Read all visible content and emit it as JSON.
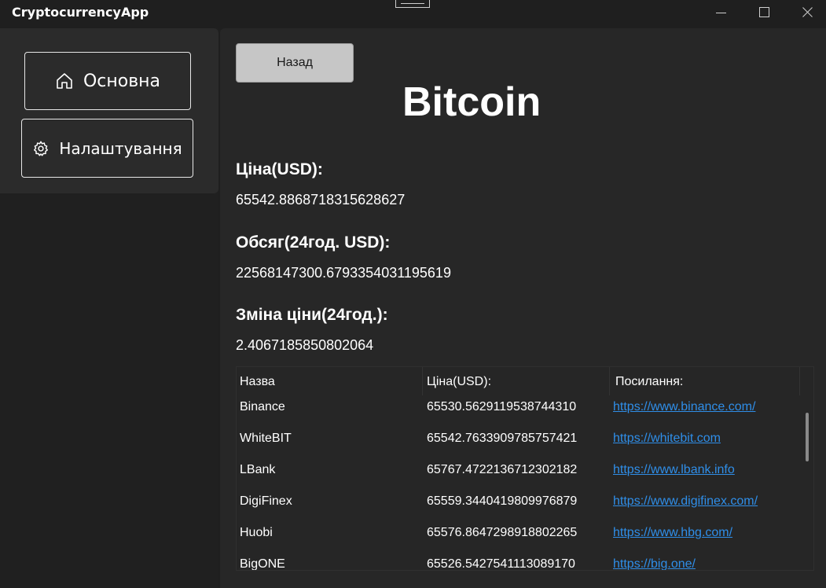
{
  "window": {
    "title": "CryptocurrencyApp"
  },
  "sidebar": {
    "items": [
      {
        "label": "Основна",
        "icon": "home-icon"
      },
      {
        "label": "Налаштування",
        "icon": "gear-icon"
      }
    ]
  },
  "main": {
    "back_label": "Назад",
    "coin_name": "Bitcoin",
    "price_label": "Ціна(USD):",
    "price_value": "65542.8868718315628627",
    "volume_label": "Обсяг(24год. USD):",
    "volume_value": "22568147300.6793354031195619",
    "change_label": "Зміна ціни(24год.):",
    "change_value": "2.4067185850802064"
  },
  "table": {
    "headers": [
      "Назва",
      "Ціна(USD):",
      "Посилання:"
    ],
    "rows": [
      {
        "name": "Binance",
        "price": "65530.5629119538744310",
        "link": "https://www.binance.com/"
      },
      {
        "name": "WhiteBIT",
        "price": "65542.7633909785757421",
        "link": "https://whitebit.com"
      },
      {
        "name": "LBank",
        "price": "65767.4722136712302182",
        "link": "https://www.lbank.info"
      },
      {
        "name": "DigiFinex",
        "price": "65559.3440419809976879",
        "link": "https://www.digifinex.com/"
      },
      {
        "name": "Huobi",
        "price": "65576.8647298918802265",
        "link": "https://www.hbg.com/"
      },
      {
        "name": "BigONE",
        "price": "65526.5427541113089170",
        "link": "https://big.one/"
      }
    ]
  },
  "colors": {
    "background": "#1f1f1f",
    "panel": "#2b2b2b",
    "link": "#2f8ee8",
    "button": "#c6c6c6"
  }
}
